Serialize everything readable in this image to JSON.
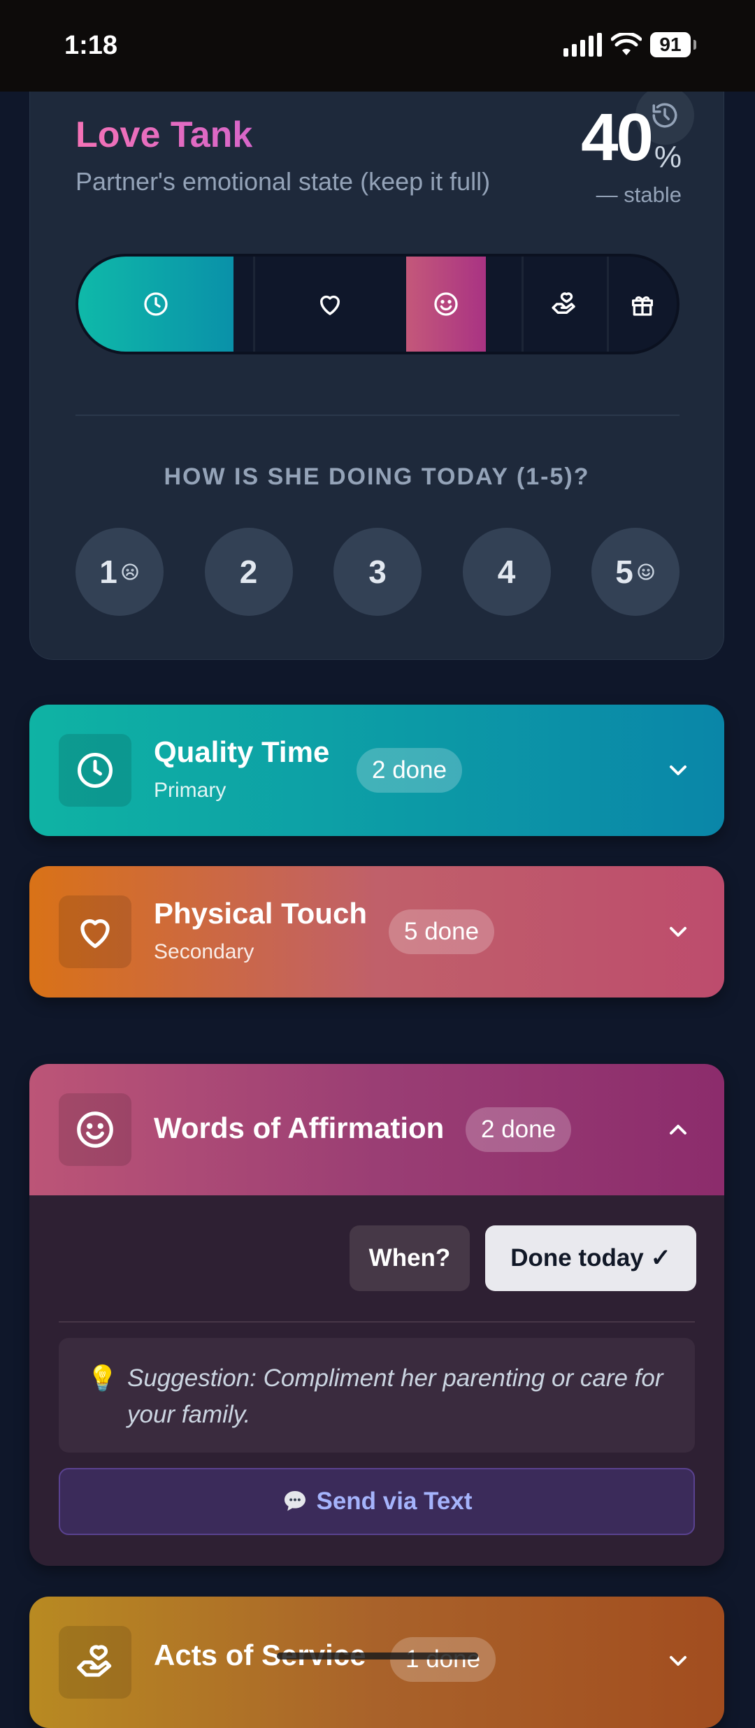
{
  "status_bar": {
    "time": "1:18",
    "battery": "91"
  },
  "love_tank": {
    "title": "Love Tank",
    "subtitle": "Partner's emotional state (keep it full)",
    "percent": "40",
    "percent_sign": "%",
    "trend": "— stable",
    "fill_level_percent": 40,
    "segments": [
      {
        "name": "Quality Time",
        "icon": "clock-icon",
        "filled": true
      },
      {
        "name": "Physical Touch",
        "icon": "heart-icon",
        "filled": false
      },
      {
        "name": "Words of Affirmation",
        "icon": "smile-icon",
        "filled": true
      },
      {
        "name": "Acts of Service",
        "icon": "hand-icon",
        "filled": false
      },
      {
        "name": "Receiving Gifts",
        "icon": "gift-icon",
        "filled": false
      }
    ]
  },
  "rating": {
    "question": "HOW IS SHE DOING TODAY (1-5)?",
    "options": [
      "1",
      "2",
      "3",
      "4",
      "5"
    ]
  },
  "languages": [
    {
      "title": "Quality Time",
      "subtitle": "Primary",
      "done": "2 done",
      "icon": "clock-icon",
      "expanded": false,
      "colors": [
        "#0fb3a4",
        "#0a86a8"
      ]
    },
    {
      "title": "Physical Touch",
      "subtitle": "Secondary",
      "done": "5 done",
      "icon": "heart-icon",
      "expanded": false,
      "colors": [
        "#d97217",
        "#bd4c6d"
      ]
    },
    {
      "title": "Words of Affirmation",
      "subtitle": "",
      "done": "2 done",
      "icon": "smile-icon",
      "expanded": true,
      "colors": [
        "#bc5577",
        "#8c2c6c"
      ]
    },
    {
      "title": "Acts of Service",
      "subtitle": "",
      "done": "1 done",
      "icon": "hand-icon",
      "expanded": false,
      "colors": [
        "#b88a22",
        "#a24d1f"
      ]
    }
  ],
  "words_panel": {
    "when_label": "When?",
    "done_today_label": "Done today ✓",
    "suggestion": "Suggestion: Compliment her parenting or care for your family.",
    "send_label": "Send via Text"
  }
}
